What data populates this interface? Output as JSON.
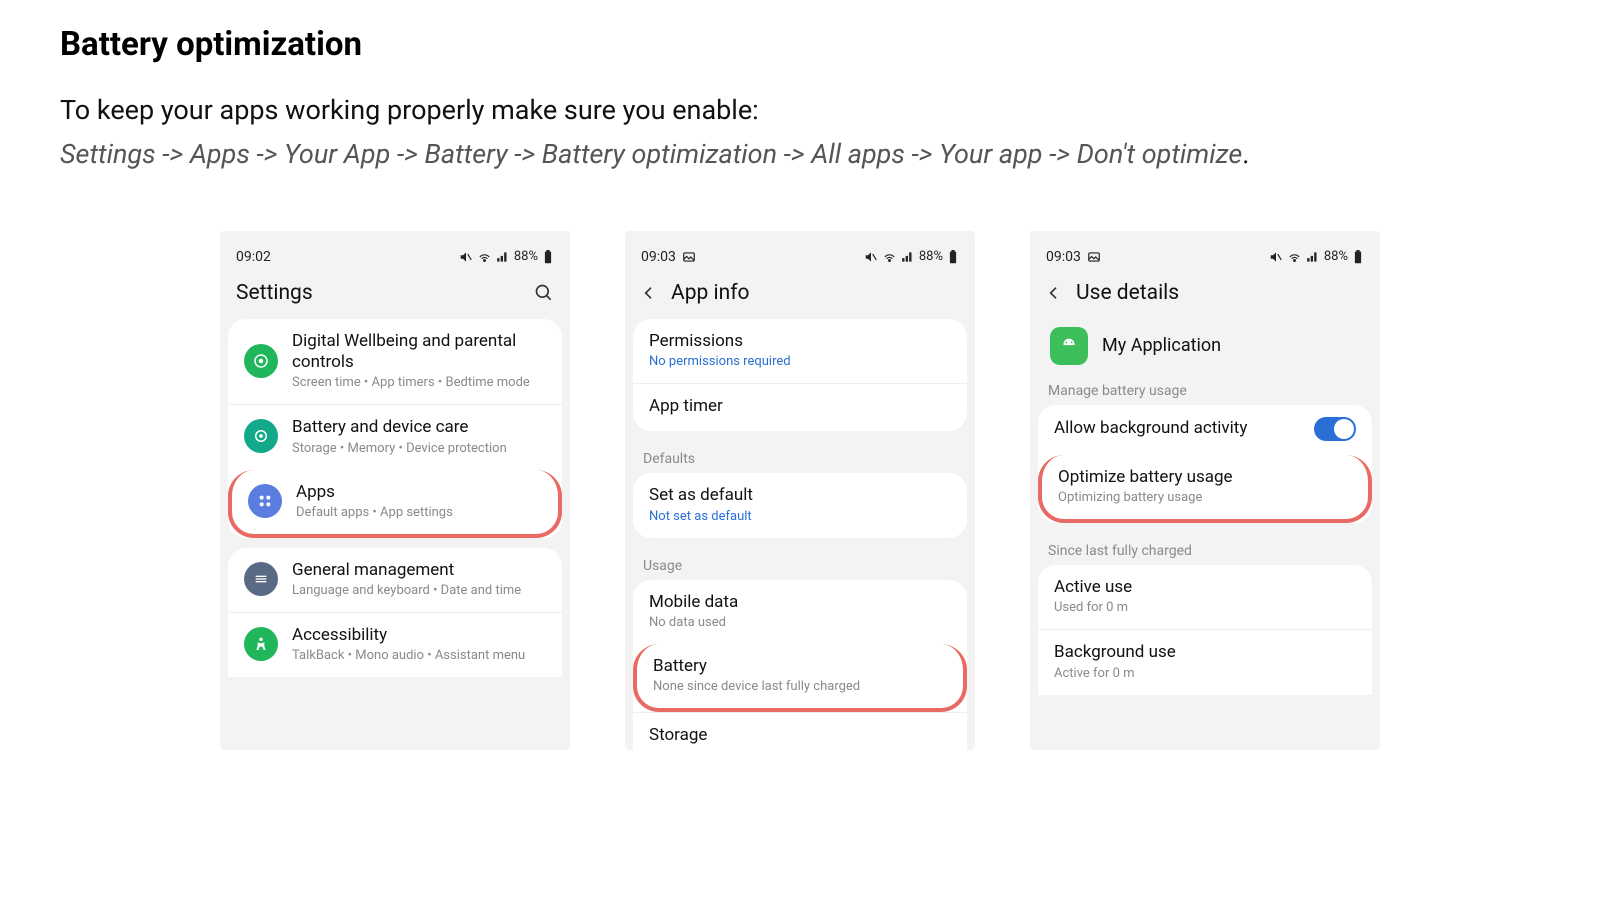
{
  "doc": {
    "heading": "Battery optimization",
    "intro": "To keep your apps working properly make sure you enable:",
    "path": "Settings -> Apps -> Your App -> Battery -> Battery optimization -> All apps -> Your app -> Don't optimize",
    "path_suffix": "."
  },
  "screen1": {
    "time": "09:02",
    "battery": "88%",
    "title": "Settings",
    "rows": {
      "wellbeing_title": "Digital Wellbeing and parental controls",
      "wellbeing_sub": "Screen time  •  App timers  •  Bedtime mode",
      "devicecare_title": "Battery and device care",
      "devicecare_sub": "Storage  •  Memory  •  Device protection",
      "apps_title": "Apps",
      "apps_sub": "Default apps  •  App settings",
      "general_title": "General management",
      "general_sub": "Language and keyboard  •  Date and time",
      "accessibility_title": "Accessibility",
      "accessibility_sub": "TalkBack  •  Mono audio  •  Assistant menu"
    }
  },
  "screen2": {
    "time": "09:03",
    "battery": "88%",
    "title": "App info",
    "rows": {
      "permissions_title": "Permissions",
      "permissions_sub": "No permissions required",
      "apptimer_title": "App timer",
      "defaults_label": "Defaults",
      "setdefault_title": "Set as default",
      "setdefault_sub": "Not set as default",
      "usage_label": "Usage",
      "mobiledata_title": "Mobile data",
      "mobiledata_sub": "No data used",
      "battery_title": "Battery",
      "battery_sub": "None since device last fully charged",
      "storage_title": "Storage"
    }
  },
  "screen3": {
    "time": "09:03",
    "battery": "88%",
    "title": "Use details",
    "app_name": "My Application",
    "rows": {
      "manage_label": "Manage battery usage",
      "allowbg_title": "Allow background activity",
      "optimize_title": "Optimize battery usage",
      "optimize_sub": "Optimizing battery usage",
      "since_label": "Since last fully charged",
      "active_title": "Active use",
      "active_sub": "Used for 0 m",
      "bg_title": "Background use",
      "bg_sub": "Active for 0 m"
    }
  }
}
